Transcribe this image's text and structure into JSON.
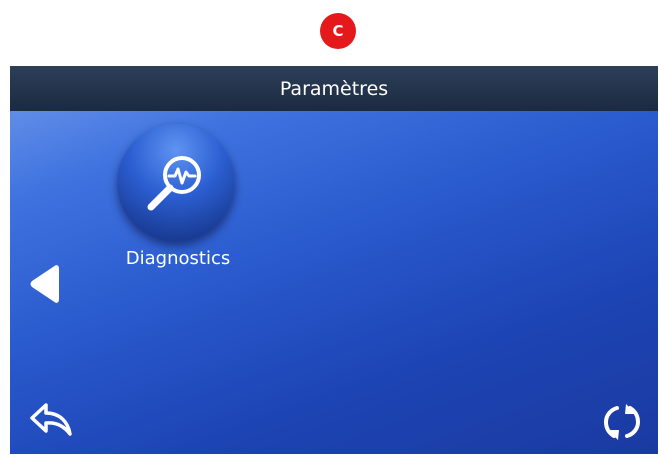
{
  "step_badge": {
    "label": "C",
    "color": "#e5191c"
  },
  "header": {
    "title": "Paramètres"
  },
  "tiles": [
    {
      "label": "Diagnostics",
      "icon": "magnifier-heartbeat-icon"
    }
  ],
  "nav": {
    "prev_icon": "triangle-left-icon",
    "back_icon": "return-arrow-icon",
    "refresh_icon": "refresh-icon"
  },
  "colors": {
    "screen_gradient_start": "#6f9aec",
    "screen_gradient_end": "#1a3aa1",
    "titlebar": "#1f2f47"
  }
}
